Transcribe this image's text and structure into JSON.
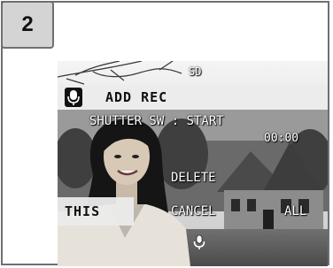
{
  "step": {
    "number": "2"
  },
  "lcd": {
    "card": "SD",
    "mode_label": "ADD REC",
    "mode_icon": "microphone-icon",
    "instruction": "SHUTTER SW : START",
    "timer": "00:00",
    "menu": {
      "delete": "DELETE",
      "this": "THIS",
      "cancel": "CANCEL",
      "all": "ALL"
    },
    "bottom_icon": "microphone-icon"
  }
}
